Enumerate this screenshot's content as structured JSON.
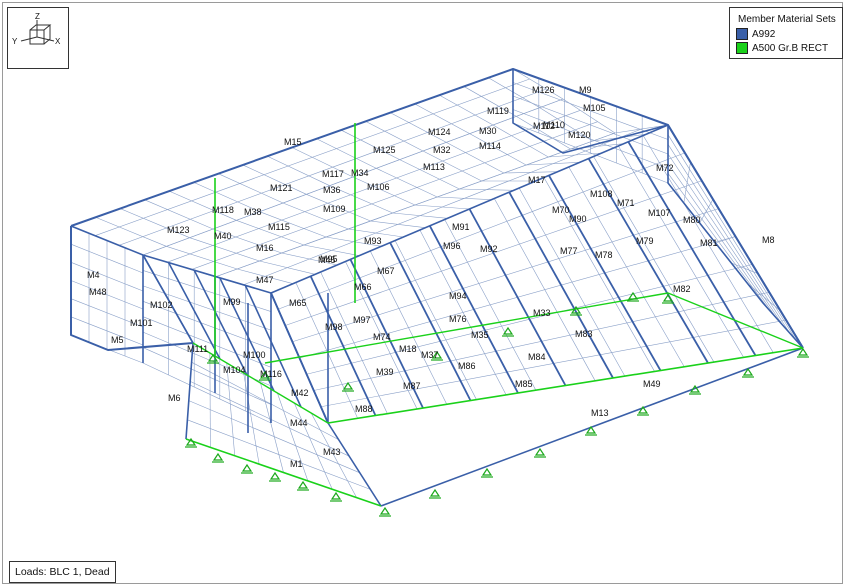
{
  "axes": {
    "z": "Z",
    "y": "Y",
    "x": "X"
  },
  "legend": {
    "title": "Member Material Sets",
    "items": [
      {
        "label": "A992",
        "color": "#3a5fa8"
      },
      {
        "label": "A500 Gr.B RECT",
        "color": "#1ad11a"
      }
    ]
  },
  "status": {
    "loads": "Loads: BLC 1, Dead"
  },
  "colors": {
    "member": "#3a5fa8",
    "mesh": "#8aa0c8",
    "green": "#1ad11a",
    "support": "#1aa81a"
  },
  "member_labels": [
    "M1",
    "M4",
    "M5",
    "M6",
    "M8",
    "M9",
    "M13",
    "M15",
    "M16",
    "M17",
    "M18",
    "M30",
    "M32",
    "M33",
    "M34",
    "M35",
    "M36",
    "M37",
    "M38",
    "M39",
    "M40",
    "M42",
    "M43",
    "M44",
    "M45",
    "M47",
    "M48",
    "M49",
    "M65",
    "M66",
    "M67",
    "M70",
    "M71",
    "M72",
    "M74",
    "M76",
    "M77",
    "M78",
    "M79",
    "M80",
    "M81",
    "M82",
    "M83",
    "M84",
    "M85",
    "M86",
    "M87",
    "M88",
    "M90",
    "M91",
    "M92",
    "M93",
    "M94",
    "M95",
    "M96",
    "M97",
    "M98",
    "M99",
    "M100",
    "M101",
    "M102",
    "M104",
    "M105",
    "M106",
    "M107",
    "M108",
    "M109",
    "M110",
    "M111",
    "M112",
    "M113",
    "M114",
    "M115",
    "M116",
    "M117",
    "M118",
    "M119",
    "M120",
    "M121",
    "M123",
    "M124",
    "M125",
    "M126"
  ]
}
